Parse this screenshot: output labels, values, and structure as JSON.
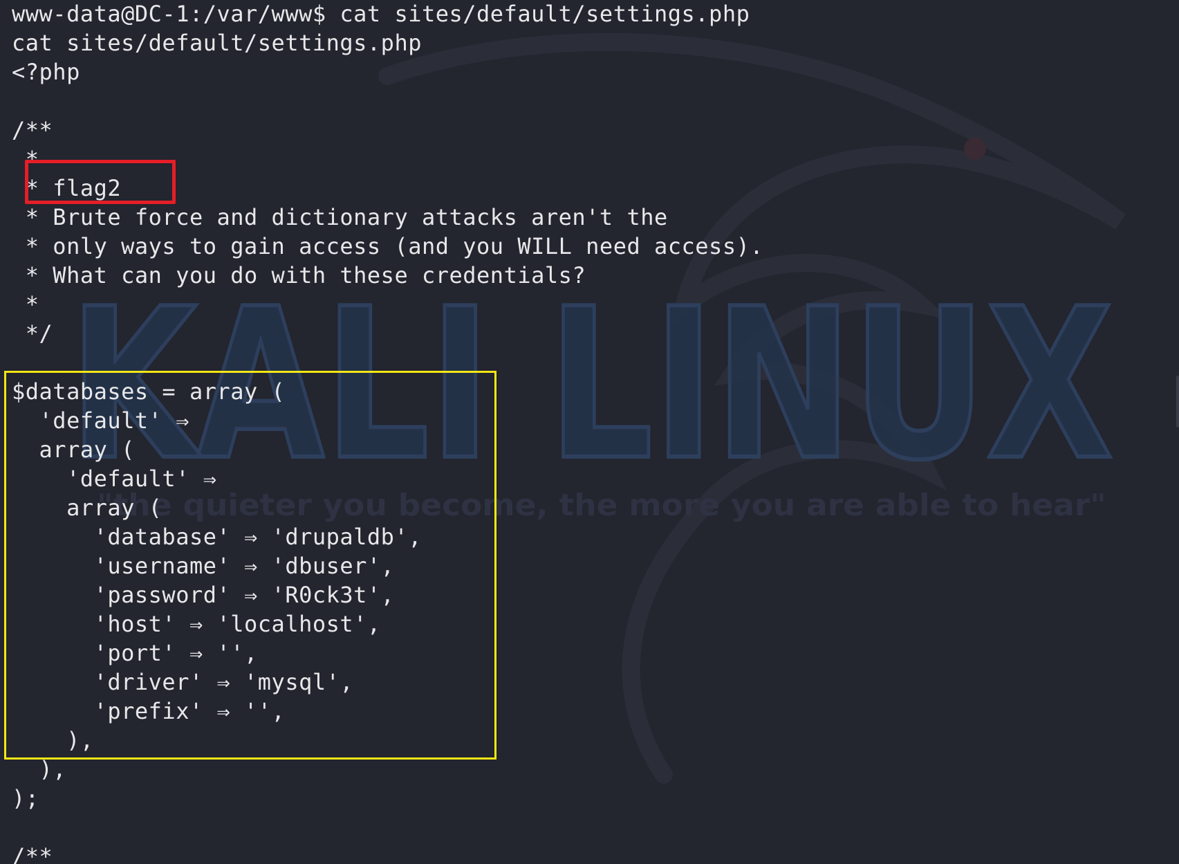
{
  "terminal": {
    "lines": [
      "www-data@DC-1:/var/www$ cat sites/default/settings.php",
      "cat sites/default/settings.php",
      "<?php",
      "",
      "/**",
      " *",
      " * flag2",
      " * Brute force and dictionary attacks aren't the",
      " * only ways to gain access (and you WILL need access).",
      " * What can you do with these credentials?",
      " *",
      " */",
      "",
      "$databases = array (",
      "  'default' ⇒",
      "  array (",
      "    'default' ⇒",
      "    array (",
      "      'database' ⇒ 'drupaldb',",
      "      'username' ⇒ 'dbuser',",
      "      'password' ⇒ 'R0ck3t',",
      "      'host' ⇒ 'localhost',",
      "      'port' ⇒ '',",
      "      'driver' ⇒ 'mysql',",
      "      'prefix' ⇒ '',",
      "    ),",
      "  ),",
      ");",
      "",
      "/**"
    ]
  },
  "wallpaper": {
    "logo_text": "KALI LINUX",
    "tagline": "\"the quieter you become, the more you are able to hear\""
  },
  "colors": {
    "background": "#23252f",
    "text": "#e8e8ea",
    "red_box": "#e51e27",
    "yellow_box": "#f5e714"
  }
}
